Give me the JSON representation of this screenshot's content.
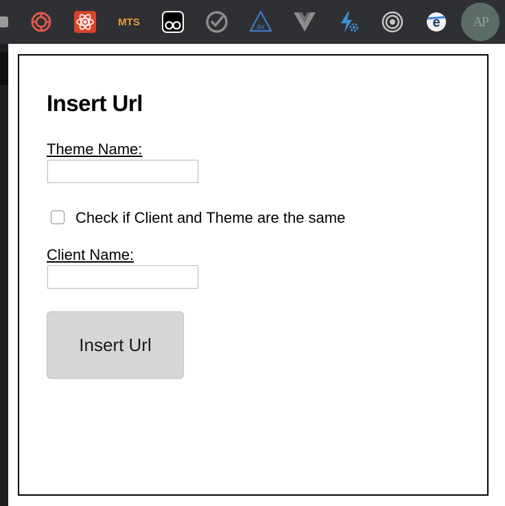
{
  "toolbar": {
    "extensions": [
      {
        "icon": "extension-badge-icon"
      },
      {
        "icon": "spiral-logo-icon",
        "color": "#e2574c"
      },
      {
        "icon": "react-atom-icon",
        "color": "#d7452f"
      },
      {
        "icon": "mts-logo-icon",
        "text": "MTS",
        "color": "#e8a23a"
      },
      {
        "icon": "tampermonkey-icon"
      },
      {
        "icon": "checkmark-circle-icon"
      },
      {
        "icon": "axe-triangle-icon",
        "text": "ax",
        "color": "#3d7ec9"
      },
      {
        "icon": "vue-logo-icon"
      },
      {
        "icon": "lightning-gear-icon",
        "color": "#3b8fd9"
      },
      {
        "icon": "target-rings-icon"
      },
      {
        "icon": "e-globe-icon",
        "text": "e"
      },
      {
        "icon": "avatar-icon",
        "text": "AP"
      }
    ]
  },
  "form": {
    "title": "Insert Url",
    "theme_label": "Theme Name:",
    "theme_value": "",
    "same_checkbox_label": "Check if Client and Theme are the same",
    "same_checked": false,
    "client_label": "Client Name:",
    "client_value": "",
    "submit_label": "Insert Url"
  }
}
